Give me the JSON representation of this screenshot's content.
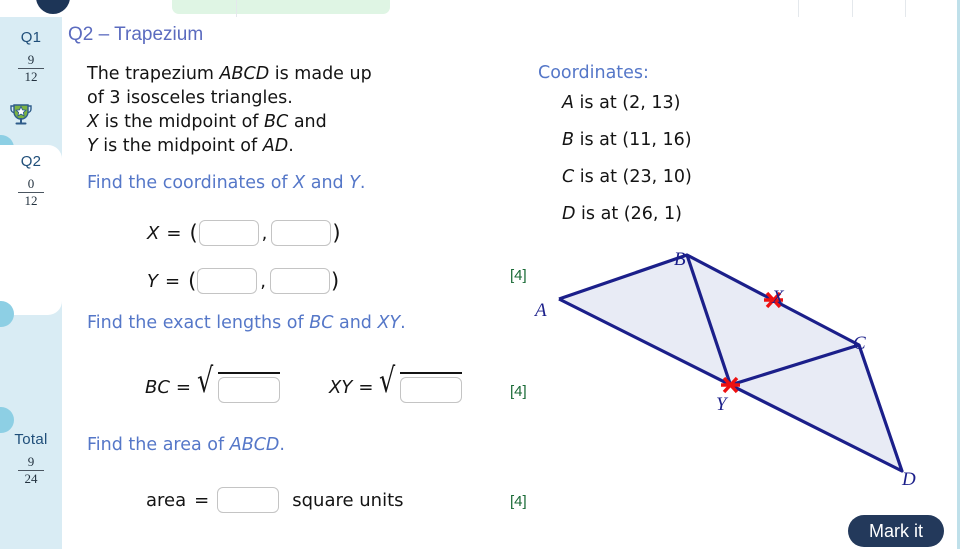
{
  "app": {
    "mark_button_label": "Mark it"
  },
  "sidebar": {
    "items": [
      {
        "label": "Q1",
        "score": "9",
        "total": "12",
        "badge": "trophy-star",
        "active": false
      },
      {
        "label": "Q2",
        "score": "0",
        "total": "12",
        "badge": "",
        "active": true
      }
    ],
    "total": {
      "label": "Total",
      "score": "9",
      "total": "24"
    }
  },
  "question": {
    "title": "Q2 – Trapezium",
    "stem_lines": [
      {
        "parts": [
          {
            "t": "The trapezium ",
            "i": false
          },
          {
            "t": "ABCD",
            "i": true
          },
          {
            "t": " is made up",
            "i": false
          }
        ]
      },
      {
        "parts": [
          {
            "t": "of 3 isosceles triangles.",
            "i": false
          }
        ]
      },
      {
        "parts": [
          {
            "t": "X",
            "i": true
          },
          {
            "t": " is the midpoint of ",
            "i": false
          },
          {
            "t": "BC",
            "i": true
          },
          {
            "t": " and",
            "i": false
          }
        ]
      },
      {
        "parts": [
          {
            "t": "Y",
            "i": true
          },
          {
            "t": " is the midpoint of ",
            "i": false
          },
          {
            "t": "AD",
            "i": true
          },
          {
            "t": ".",
            "i": false
          }
        ]
      }
    ],
    "prompts": [
      {
        "parts": [
          {
            "t": "Find the coordinates of ",
            "i": false
          },
          {
            "t": "X",
            "i": true
          },
          {
            "t": " and ",
            "i": false
          },
          {
            "t": "Y",
            "i": true
          },
          {
            "t": ".",
            "i": false
          }
        ]
      },
      {
        "parts": [
          {
            "t": "Find the exact lengths of ",
            "i": false
          },
          {
            "t": "BC",
            "i": true
          },
          {
            "t": " and ",
            "i": false
          },
          {
            "t": "XY",
            "i": true
          },
          {
            "t": ".",
            "i": false
          }
        ]
      },
      {
        "parts": [
          {
            "t": "Find the area of ",
            "i": false
          },
          {
            "t": "ABCD",
            "i": true
          },
          {
            "t": ".",
            "i": false
          }
        ]
      }
    ],
    "answers": {
      "x_label": "X",
      "y_label": "Y",
      "equals": "=",
      "open_paren": "(",
      "close_paren": ")",
      "comma": ",",
      "x_coord_x": "",
      "x_coord_y": "",
      "y_coord_x": "",
      "y_coord_y": "",
      "bc_label": "BC",
      "xy_label": "XY",
      "bc_value": "",
      "xy_value": "",
      "area_label": "area",
      "area_value": "",
      "area_units": "square units"
    },
    "marks": [
      "[4]",
      "[4]",
      "[4]"
    ]
  },
  "coordinates": {
    "heading": "Coordinates:",
    "points": [
      {
        "name": "A",
        "text": " is at (2, 13)"
      },
      {
        "name": "B",
        "text": " is at (11, 16)"
      },
      {
        "name": "C",
        "text": " is at (23, 10)"
      },
      {
        "name": "D",
        "text": " is at (26, 1)"
      }
    ]
  },
  "diagram": {
    "vertex_labels": {
      "A": "A",
      "B": "B",
      "C": "C",
      "D": "D",
      "X": "X",
      "Y": "Y"
    },
    "colors": {
      "stroke": "#1b1f8a",
      "fill": "#e8ebf5",
      "marker": "#ee1111",
      "label": "#1b1f8a"
    }
  },
  "colors": {
    "sidebar_bg": "#d9ecf4",
    "title": "#5b6bbf",
    "prompt": "#5577c8",
    "marks": "#1b6b37",
    "button_bg": "#23395b",
    "accent_rail": "#bfe0ea"
  }
}
